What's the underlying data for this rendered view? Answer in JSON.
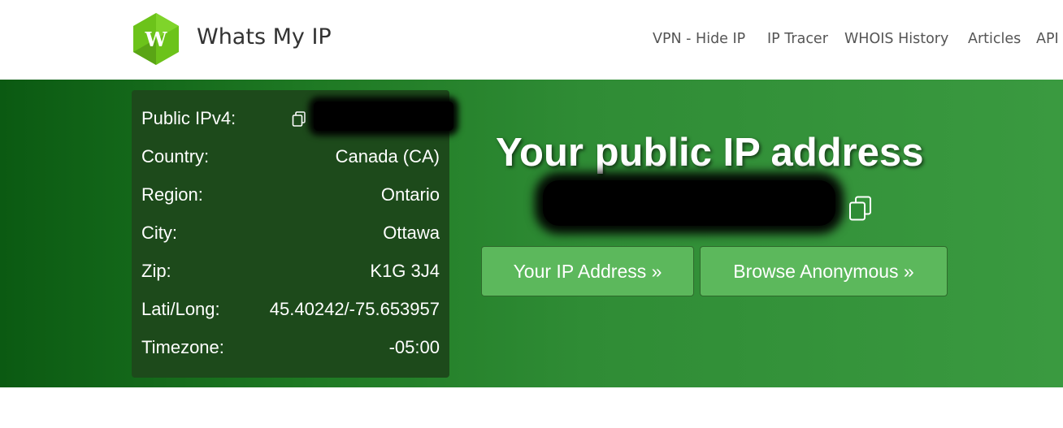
{
  "header": {
    "logo_letter": "W",
    "brand": "Whats My IP",
    "nav": [
      "VPN - Hide IP",
      "IP Tracer",
      "WHOIS History",
      "Articles",
      "API"
    ]
  },
  "info": {
    "rows": [
      {
        "label": "Public IPv4:",
        "value": ""
      },
      {
        "label": "Country:",
        "value": "Canada (CA)"
      },
      {
        "label": "Region:",
        "value": "Ontario"
      },
      {
        "label": "City:",
        "value": "Ottawa"
      },
      {
        "label": "Zip:",
        "value": "K1G 3J4"
      },
      {
        "label": "Lati/Long:",
        "value": "45.40242/-75.653957"
      },
      {
        "label": "Timezone:",
        "value": "-05:00"
      }
    ]
  },
  "hero": {
    "title": "Your public IP address",
    "buttons": {
      "your_ip": "Your IP Address »",
      "browse": "Browse Anonymous »"
    }
  },
  "icons": {
    "logo": "hexagon-w-logo",
    "copy": "copy-icon"
  },
  "colors": {
    "brand_green": "#5cb85c",
    "hero_dark": "#0b5a12",
    "hero_light": "#3a9a40",
    "panel": "#1d4a1b"
  }
}
